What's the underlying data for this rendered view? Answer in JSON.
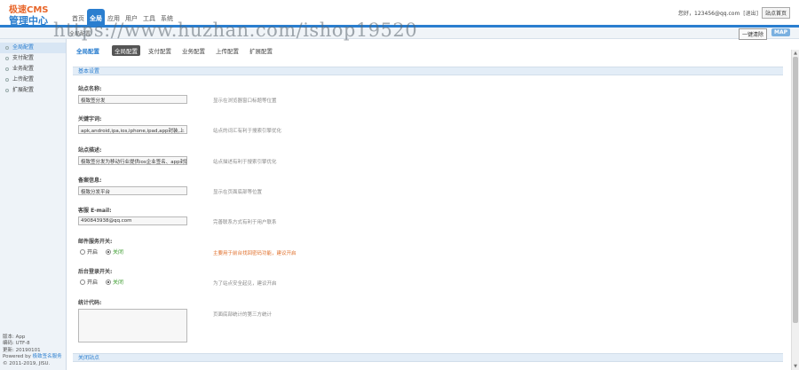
{
  "header": {
    "logo_line1": "极速CMS",
    "logo_line2": "管理中心",
    "nav": [
      "首页",
      "全局",
      "应用",
      "用户",
      "工具",
      "系统"
    ],
    "user_text": "您好，123456@qq.com",
    "logout_label": "[退出]",
    "site_home_label": "站点首页",
    "clear_cache_label": "一键清除",
    "map_label": "MAP",
    "breadcrumb": "全局配置",
    "watermark": "https://www.huzhan.com/ishop19520"
  },
  "sidebar": {
    "items": [
      "全局配置",
      "支付配置",
      "业务配置",
      "上传配置",
      "扩展配置"
    ],
    "footer": {
      "version": "版本: App",
      "encoding": "编码: UTF-8",
      "update": "更新: 20190101",
      "powered_prefix": "Powered by",
      "powered_link": "极致签名服务",
      "copyright": "© 2011-2019, JISU."
    }
  },
  "main": {
    "tabs_title": "全局配置",
    "tabs": [
      "全局配置",
      "支付配置",
      "业务配置",
      "上传配置",
      "扩展配置"
    ],
    "section_basic": "基本设置",
    "fields": {
      "site_name": {
        "label": "站点名称:",
        "value": "极致签分发",
        "tip": "显示在浏览器窗口标题等位置"
      },
      "keywords": {
        "label": "关键字词:",
        "value": "apk,android,ipa,ios,iphone,ipad,app封装,上",
        "tip": "站点的词汇有利于搜索引擎优化"
      },
      "description": {
        "label": "站点描述:",
        "value": "极致签分发为移动行业提供ios企业签名、app封装",
        "tip": "站点描述有利于搜索引擎优化"
      },
      "filing": {
        "label": "备案信息:",
        "value": "极致分发平台",
        "tip": "显示在页面底部等位置"
      },
      "email": {
        "label": "客服 E-mail:",
        "value": "490843938@qq.com",
        "tip": "完善联系方式有利于用户联系"
      },
      "mail_service": {
        "label": "邮件服务开关:",
        "on": "开启",
        "off": "关闭",
        "tip": "主要用于前台找回密码功能，建议开启"
      },
      "admin_login": {
        "label": "后台登录开关:",
        "on": "开启",
        "off": "关闭",
        "tip": "为了站点安全起见，建议开启"
      },
      "stats_code": {
        "label": "统计代码:",
        "tip": "页面底部统计的第三方统计"
      }
    },
    "section_close": "关闭站点"
  },
  "colors": {
    "accent": "#2a7ecf",
    "logo_orange": "#e8662a",
    "warn": "#e0702c",
    "green": "#3a9b2c"
  }
}
